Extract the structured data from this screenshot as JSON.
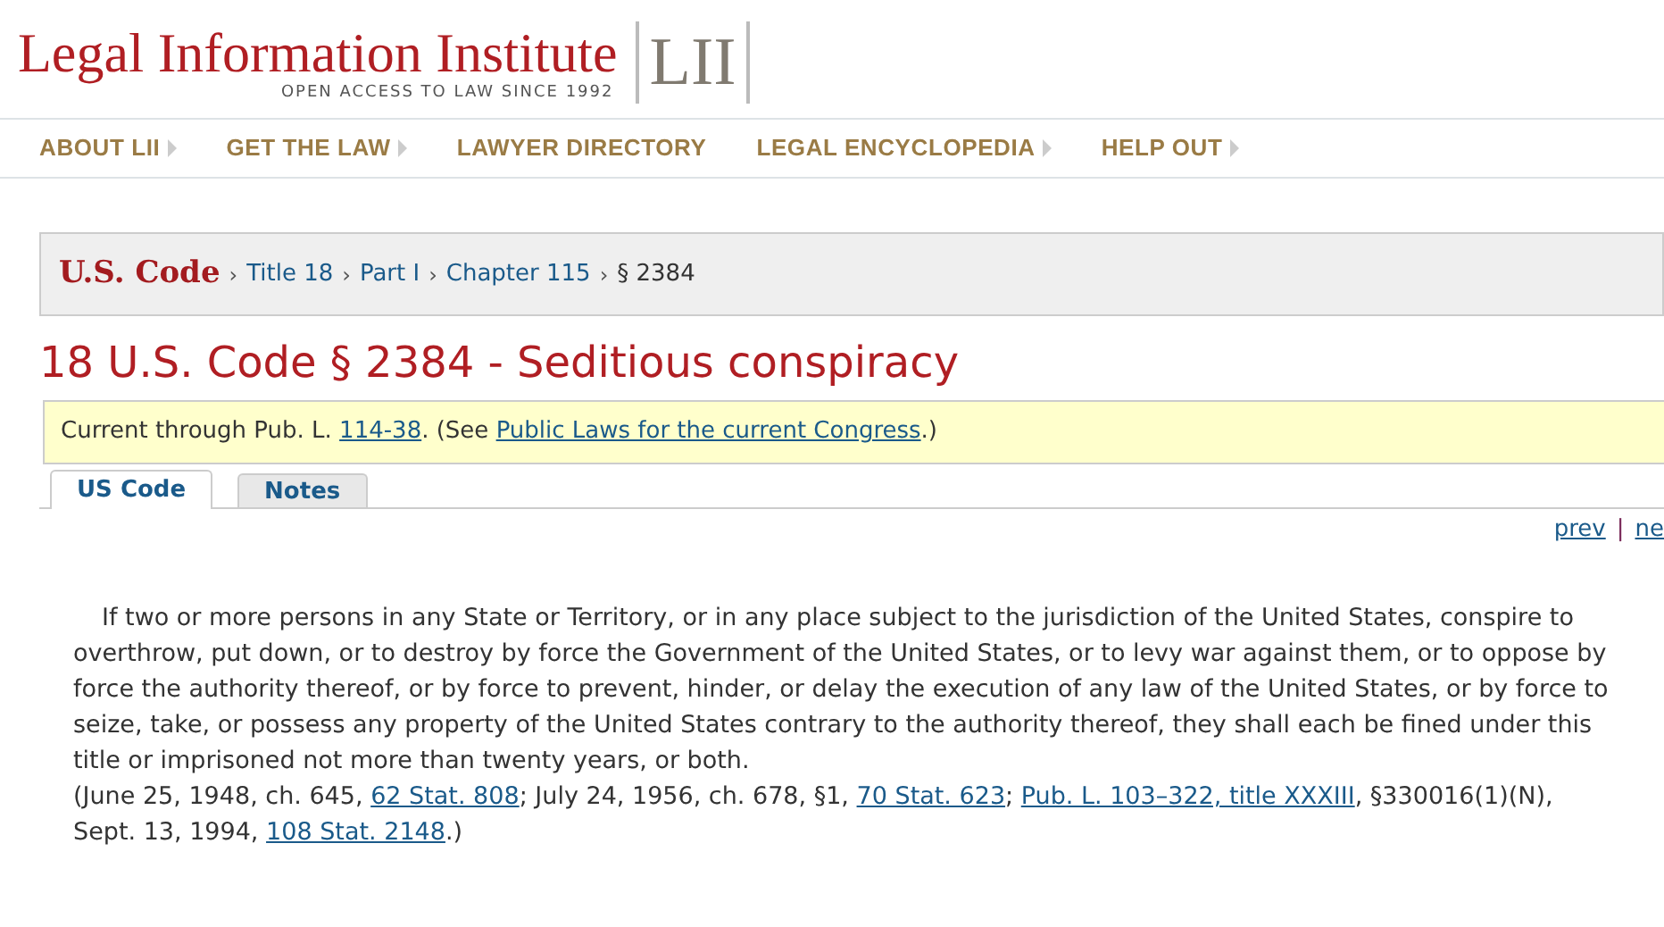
{
  "header": {
    "site_name": "Legal Information Institute",
    "tagline": "OPEN ACCESS TO LAW SINCE 1992",
    "logo_mark": "LII"
  },
  "nav": [
    {
      "label": "ABOUT LII",
      "has_submenu": true
    },
    {
      "label": "GET THE LAW",
      "has_submenu": true
    },
    {
      "label": "LAWYER DIRECTORY",
      "has_submenu": false
    },
    {
      "label": "LEGAL ENCYCLOPEDIA",
      "has_submenu": true
    },
    {
      "label": "HELP OUT",
      "has_submenu": true
    }
  ],
  "breadcrumb": {
    "root": "U.S. Code",
    "separator": "›",
    "items": [
      {
        "label": "Title 18",
        "link": true
      },
      {
        "label": "Part I",
        "link": true
      },
      {
        "label": "Chapter 115",
        "link": true
      },
      {
        "label": "§ 2384",
        "link": false
      }
    ]
  },
  "page_title": "18 U.S. Code § 2384 - Seditious conspiracy",
  "notice": [
    {
      "text": "Current through Pub. L. ",
      "link": false
    },
    {
      "text": "114-38",
      "link": true
    },
    {
      "text": ". (See ",
      "link": false
    },
    {
      "text": "Public Laws for the current Congress",
      "link": true
    },
    {
      "text": ".)",
      "link": false
    }
  ],
  "tabs": [
    {
      "label": "US Code",
      "selected": true
    },
    {
      "label": "Notes",
      "selected": false
    }
  ],
  "pager": {
    "prev": "prev",
    "divider": "|",
    "next": "ne"
  },
  "body": "If two or more persons in any State or Territory, or in any place subject to the jurisdiction of the United States, conspire to overthrow, put down, or to destroy by force the Government of the United States, or to levy war against them, or to oppose by force the authority thereof, or by force to prevent, hinder, or delay the execution of any law of the United States, or by force to seize, take, or possess any property of the United States contrary to the authority thereof, they shall each be fined under this title or imprisoned not more than twenty years, or both.",
  "source_note": [
    {
      "text": "(June 25, 1948, ch. 645, ",
      "link": false
    },
    {
      "text": "62 Stat. 808",
      "link": true
    },
    {
      "text": "; July 24, 1956, ch. 678, §1, ",
      "link": false
    },
    {
      "text": "70 Stat. 623",
      "link": true
    },
    {
      "text": "; ",
      "link": false
    },
    {
      "text": "Pub. L. 103–322, title XXXIII",
      "link": true
    },
    {
      "text": ", §330016(1)(N), Sept. 13, 1994, ",
      "link": false
    },
    {
      "text": "108 Stat. 2148",
      "link": true
    },
    {
      "text": ".)",
      "link": false
    }
  ]
}
